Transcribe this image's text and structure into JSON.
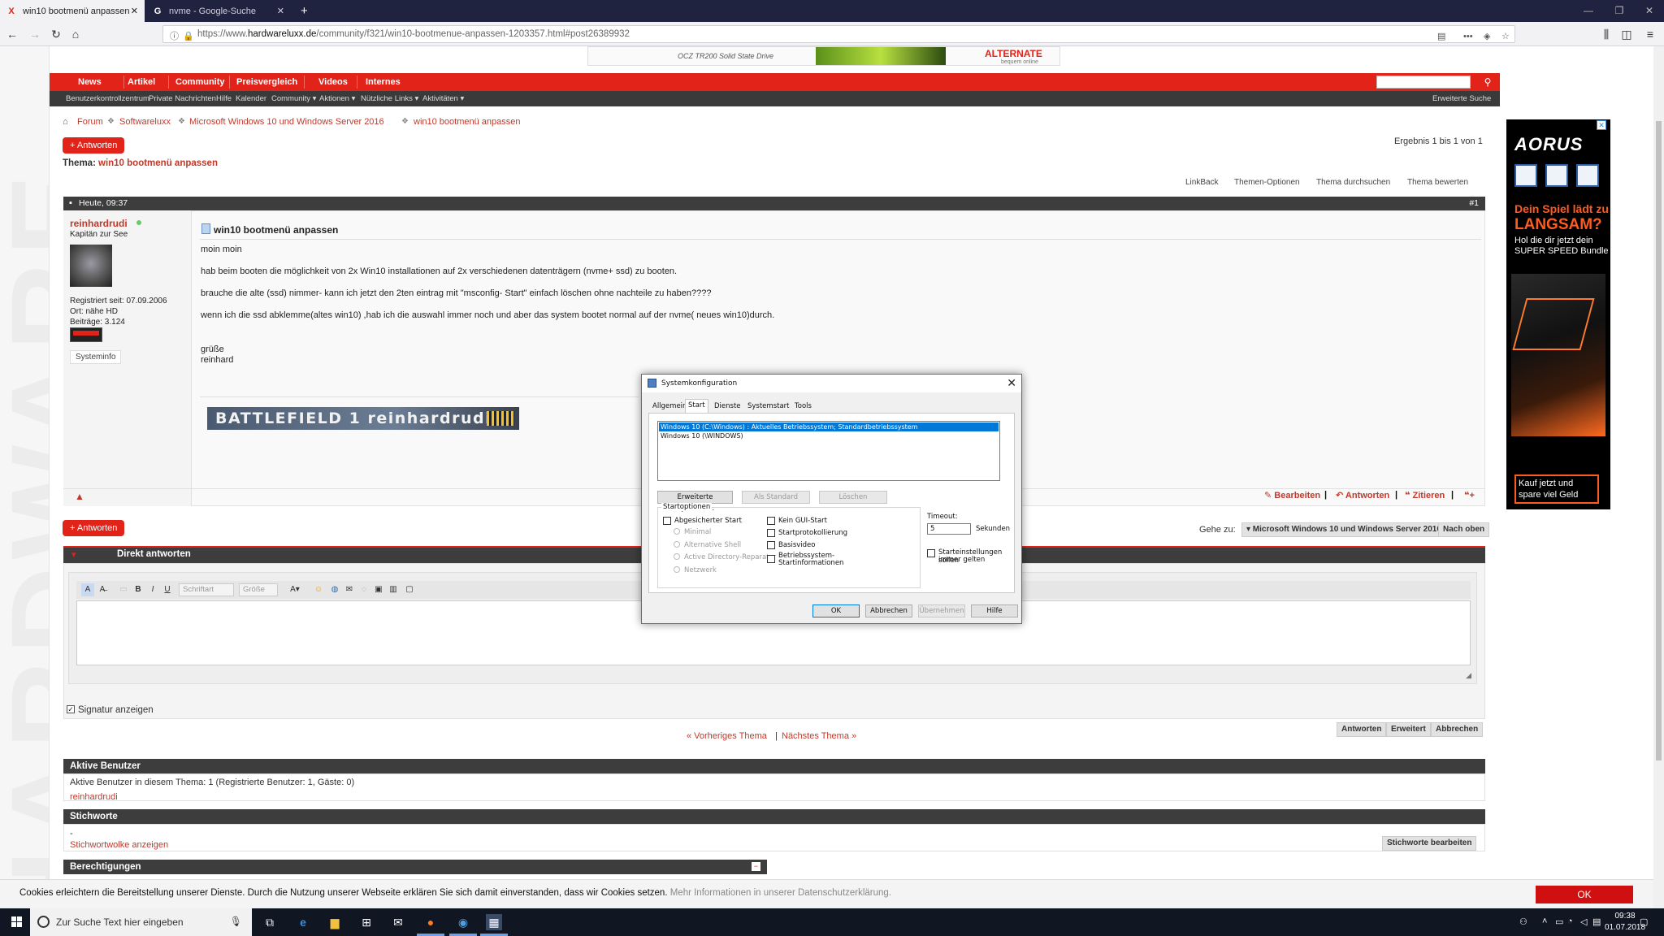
{
  "browser": {
    "tabs": [
      {
        "title": "win10 bootmenü anpassen",
        "favicon": "hardwareluxx-icon",
        "active": true
      },
      {
        "title": "nvme - Google-Suche",
        "favicon": "google-icon",
        "active": false
      }
    ],
    "new_tab_label": "+",
    "url_prefix": "https://www.",
    "url_domain": "hardwareluxx.de",
    "url_path": "/community/f321/win10-bootmenue-anpassen-1203357.html#post26389932"
  },
  "top_ad": {
    "product": "OCZ TR200 Solid State Drive",
    "brand": "ALTERNATE",
    "brand_tag": "bequem online"
  },
  "main_nav": [
    "News",
    "Artikel",
    "Community",
    "Preisvergleich",
    "Videos",
    "Internes"
  ],
  "sub_nav": [
    "Benutzerkontrollzentrum",
    "Private Nachrichten",
    "Hilfe",
    "Kalender",
    "Community ▾",
    "Aktionen ▾",
    "Nützliche Links ▾",
    "Aktivitäten ▾"
  ],
  "advanced_search": "Erweiterte Suche",
  "breadcrumb": [
    "Forum",
    "Softwareluxx",
    "Microsoft Windows 10 und Windows Server 2016",
    "win10 bootmenü anpassen"
  ],
  "reply_button": "+ Antworten",
  "results": "Ergebnis 1 bis 1 von 1",
  "thread": {
    "label": "Thema:",
    "title": "win10 bootmenü anpassen"
  },
  "thread_tools": [
    "LinkBack",
    "Themen-Optionen",
    "Thema durchsuchen",
    "Thema bewerten"
  ],
  "post": {
    "date": "Heute, 09:37",
    "number": "#1",
    "author": "reinhardrudi",
    "rank": "Kapitän zur See",
    "registered": "Registriert seit: 07.09.2006",
    "location": "Ort: nähe HD",
    "posts": "Beiträge: 3.124",
    "sysinfo": "Systeminfo",
    "title": "win10 bootmenü anpassen",
    "lines": [
      "moin moin",
      "hab beim booten die möglichkeit von 2x Win10 installationen auf 2x verschiedenen datenträgern (nvme+ ssd) zu booten.",
      "brauche die alte (ssd) nimmer- kann ich jetzt den 2ten eintrag mit \"msconfig- Start\" einfach löschen ohne nachteile zu haben????",
      "wenn ich die ssd abklemme(altes win10) ,hab ich die auswahl immer noch und aber das system bootet normal auf der nvme( neues win10)durch.",
      "grüße",
      "reinhard"
    ],
    "signature": "BATTLEFIELD 1 reinhardrudii",
    "actions": [
      "Bearbeiten",
      "Antworten",
      "Zitieren"
    ]
  },
  "goto": {
    "label": "Gehe zu:",
    "forum": "▾ Microsoft Windows 10 und Windows Server 2016",
    "top": "Nach oben"
  },
  "quick_reply": {
    "title": "Direkt antworten",
    "font_label": "Schriftart",
    "size_label": "Größe",
    "show_signature": "Signatur anzeigen",
    "buttons": [
      "Antworten",
      "Erweitert",
      "Abbrechen"
    ]
  },
  "thread_nav": {
    "prev": "« Vorheriges Thema",
    "sep": "|",
    "next": "Nächstes Thema »"
  },
  "active_users": {
    "title": "Aktive Benutzer",
    "text": "Aktive Benutzer in diesem Thema: 1 (Registrierte Benutzer: 1, Gäste: 0)",
    "user": "reinhardrudi"
  },
  "tags": {
    "title": "Stichworte",
    "dash": "-",
    "cloud_link": "Stichwortwolke anzeigen",
    "edit_button": "Stichworte bearbeiten"
  },
  "permissions": {
    "title": "Berechtigungen"
  },
  "dialog": {
    "title": "Systemkonfiguration",
    "tabs": [
      "Allgemein",
      "Start",
      "Dienste",
      "Systemstart",
      "Tools"
    ],
    "active_tab": "Start",
    "boot_entries": [
      "Windows 10 (C:\\Windows) : Aktuelles Betriebssystem; Standardbetriebssystem",
      "Windows 10 (\\WINDOWS)"
    ],
    "buttons_row": [
      "Erweiterte Optionen...",
      "Als Standard",
      "Löschen"
    ],
    "startoptions_label": "Startoptionen",
    "options_left": [
      "Abgesicherter Start",
      "Minimal",
      "Alternative Shell",
      "Active Directory-Reparatur",
      "Netzwerk"
    ],
    "options_right": [
      "Kein GUI-Start",
      "Startprotokollierung",
      "Basisvideo",
      "Betriebssystem-",
      "Startinformationen"
    ],
    "timeout_label": "Timeout:",
    "timeout_value": "5",
    "seconds": "Sekunden",
    "permanent_1": "Starteinstellungen sollen",
    "permanent_2": "immer gelten",
    "footer_buttons": [
      "OK",
      "Abbrechen",
      "Übernehmen",
      "Hilfe"
    ]
  },
  "side_ad": {
    "brand": "AORUS",
    "line1": "Dein Spiel lädt zu",
    "line2": "LANGSAM?",
    "line3": "Hol die dir jetzt dein SUPER SPEED Bundle",
    "cta": "Kauf jetzt und spare viel Geld"
  },
  "cookie": {
    "text": "Cookies erleichtern die Bereitstellung unserer Dienste. Durch die Nutzung unserer Webseite erklären Sie sich damit einverstanden, dass wir Cookies setzen.",
    "more": "Mehr Informationen in unserer Datenschutzerklärung.",
    "ok": "OK"
  },
  "taskbar": {
    "search_placeholder": "Zur Suche Text hier eingeben",
    "time": "09:38",
    "date": "01.07.2018"
  }
}
